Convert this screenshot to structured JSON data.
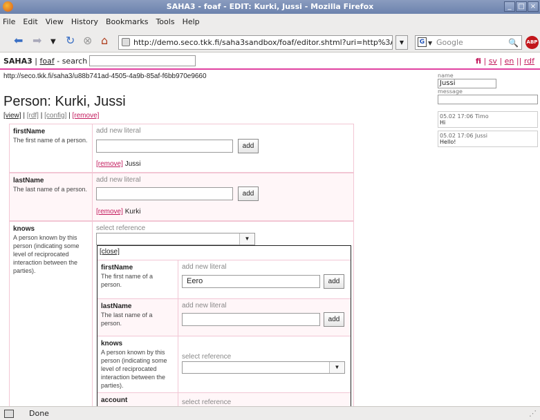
{
  "window": {
    "title": "SAHA3 - foaf - EDIT: Kurki, Jussi - Mozilla Firefox"
  },
  "menu": [
    "File",
    "Edit",
    "View",
    "History",
    "Bookmarks",
    "Tools",
    "Help"
  ],
  "navbar": {
    "url": "http://demo.seco.tkk.fi/saha3sandbox/foaf/editor.shtml?uri=http%3A%2F%",
    "search_placeholder": "Google"
  },
  "topbar": {
    "brand": "SAHA3",
    "sep1": " | ",
    "project": "foaf",
    "search_label": " - search",
    "lang_fi": "fi",
    "lang_sep1": " | ",
    "lang_sv": "sv",
    "lang_sep2": " | ",
    "lang_en": "en",
    "lang_sep3": " || ",
    "lang_rdf": "rdf"
  },
  "resource": {
    "uri": "http://seco.tkk.fi/saha3/u88b741ad-4505-4a9b-85af-f6bb970e9660",
    "title": "Person: Kurki, Jussi",
    "actions": {
      "view": "[view]",
      "rdf": "[rdf]",
      "config": "[config]",
      "remove": "[remove]",
      "sep": " | "
    }
  },
  "properties": [
    {
      "name": "firstName",
      "desc": "The first name of a person.",
      "hint": "add new literal",
      "add": "add",
      "remove": "[remove]",
      "value": "Jussi"
    },
    {
      "name": "lastName",
      "desc": "The last name of a person.",
      "hint": "add new literal",
      "add": "add",
      "remove": "[remove]",
      "value": "Kurki"
    },
    {
      "name": "knows",
      "desc": "A person known by this person (indicating some level of reciprocated interaction between the parties).",
      "hint": "select reference"
    }
  ],
  "nested": {
    "close": "[close]",
    "rows": [
      {
        "name": "firstName",
        "desc": "The first name of a person.",
        "hint": "add new literal",
        "value": "Eero",
        "add": "add"
      },
      {
        "name": "lastName",
        "desc": "The last name of a person.",
        "hint": "add new literal",
        "value": "",
        "add": "add"
      },
      {
        "name": "knows",
        "desc": "A person known by this person (indicating some level of reciprocated interaction between the parties).",
        "hint": "select reference"
      },
      {
        "name": "account",
        "desc": "",
        "hint": "select reference"
      }
    ]
  },
  "chat": {
    "name_label": "name",
    "name_value": "Jussi",
    "message_label": "message",
    "messages": [
      {
        "meta": "05.02 17:06 Timo",
        "text": "Hi"
      },
      {
        "meta": "05.02 17:06 Jussi",
        "text": "Hello!"
      }
    ]
  },
  "status": {
    "text": "Done"
  }
}
